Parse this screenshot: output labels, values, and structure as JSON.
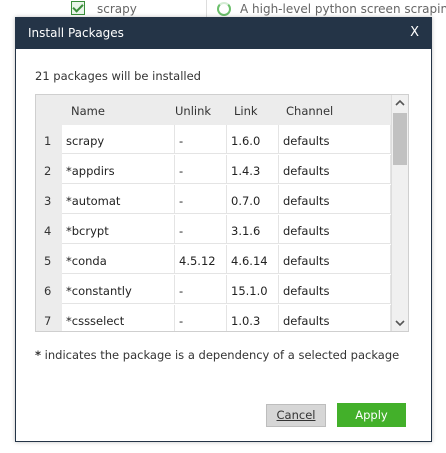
{
  "background": {
    "package_name": "scrapy",
    "description": "A high-level python screen scraping f"
  },
  "dialog": {
    "title": "Install Packages",
    "close_label": "X",
    "subtitle": "21 packages will be installed",
    "columns": [
      "Name",
      "Unlink",
      "Link",
      "Channel"
    ],
    "rows": [
      {
        "num": "1",
        "name": "scrapy",
        "unlink": "-",
        "link": "1.6.0",
        "channel": "defaults"
      },
      {
        "num": "2",
        "name": "*appdirs",
        "unlink": "-",
        "link": "1.4.3",
        "channel": "defaults"
      },
      {
        "num": "3",
        "name": "*automat",
        "unlink": "-",
        "link": "0.7.0",
        "channel": "defaults"
      },
      {
        "num": "4",
        "name": "*bcrypt",
        "unlink": "-",
        "link": "3.1.6",
        "channel": "defaults"
      },
      {
        "num": "5",
        "name": "*conda",
        "unlink": "4.5.12",
        "link": "4.6.14",
        "channel": "defaults"
      },
      {
        "num": "6",
        "name": "*constantly",
        "unlink": "-",
        "link": "15.1.0",
        "channel": "defaults"
      },
      {
        "num": "7",
        "name": "*cssselect",
        "unlink": "-",
        "link": "1.0.3",
        "channel": "defaults"
      }
    ],
    "footnote_star": "*",
    "footnote_text": " indicates the package is a dependency of a selected package",
    "cancel_label": "Cancel",
    "apply_label": "Apply",
    "colors": {
      "titlebar": "#243447",
      "apply": "#43b02a"
    }
  }
}
